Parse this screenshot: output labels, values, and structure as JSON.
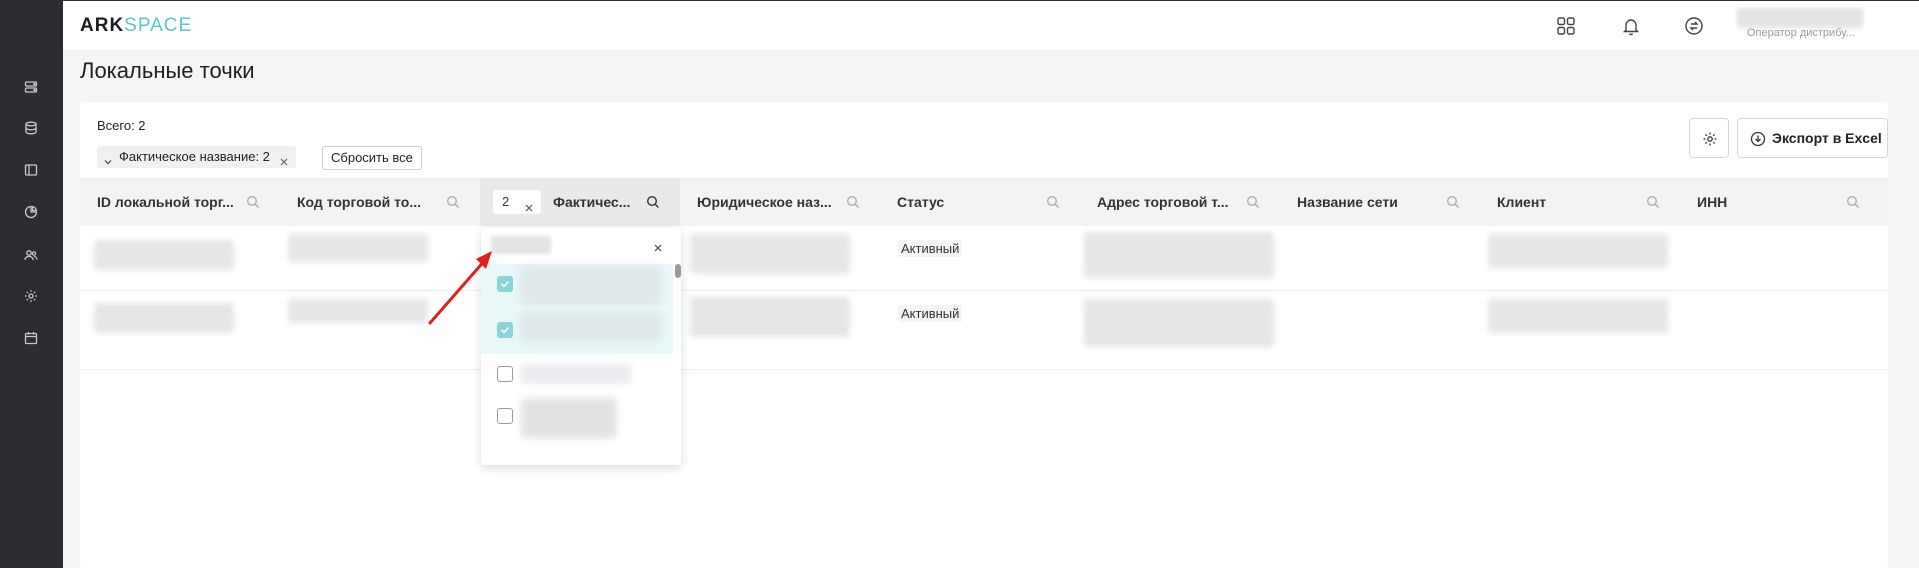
{
  "app": {
    "logo_part1": "ARK",
    "logo_part2": "SPACE",
    "user_role": "Оператор дистрибу..."
  },
  "sidebar": {
    "icons": [
      "server-icon",
      "database-icon",
      "layout-icon",
      "pie-chart-icon",
      "users-icon",
      "gear-icon",
      "calendar-icon"
    ]
  },
  "page": {
    "title": "Локальные точки",
    "total": "Всего: 2"
  },
  "filters": {
    "chip_label": "Фактическое название: 2",
    "reset_label": "Сбросить все"
  },
  "toolbar": {
    "export_label": "Экспорт в Excel"
  },
  "table": {
    "columns": [
      {
        "label": "ID локальной торг..."
      },
      {
        "label": "Код торговой то..."
      },
      {
        "label": "Фактичес...",
        "filter_count": "2"
      },
      {
        "label": "Юридическое наз..."
      },
      {
        "label": "Статус"
      },
      {
        "label": "Адрес торговой т..."
      },
      {
        "label": "Название сети"
      },
      {
        "label": "Клиент"
      },
      {
        "label": "ИНН"
      }
    ],
    "rows": [
      {
        "status": "Активный"
      },
      {
        "status": "Активный"
      }
    ]
  },
  "dropdown": {
    "items": [
      {
        "checked": true
      },
      {
        "checked": true
      },
      {
        "checked": false
      },
      {
        "checked": false
      }
    ]
  },
  "colors": {
    "accent": "#5bc4ce",
    "sidebar_bg": "#2b2d31",
    "annotation_arrow": "#e02020"
  }
}
